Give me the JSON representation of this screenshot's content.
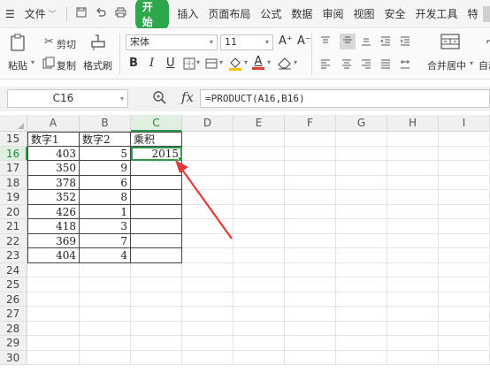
{
  "menubar": {
    "menu_icon": "☰",
    "file": "文件",
    "file_caret": "﹀",
    "tabs": [
      "插入",
      "页面布局",
      "公式",
      "数据",
      "审阅",
      "视图",
      "安全",
      "开发工具",
      "特"
    ],
    "active_tab": "开始"
  },
  "ribbon": {
    "paste_label": "粘贴",
    "cut_label": "剪切",
    "copy_label": "复制",
    "format_painter_label": "格式刷",
    "font_name": "宋体",
    "font_size": "11",
    "bold": "B",
    "italic": "I",
    "underline": "U",
    "grow_font": "A⁺",
    "shrink_font": "A⁻",
    "merge_center_label": "合并居中",
    "auto_wrap_label": "自动",
    "font_color_letter": "A",
    "font_color": "#e03c31",
    "fill_color": "#f2c500"
  },
  "formula_bar": {
    "cell_ref": "C16",
    "fx": "fx",
    "formula": "=PRODUCT(A16,B16)"
  },
  "sheet": {
    "columns": [
      "A",
      "B",
      "C",
      "D",
      "E",
      "F",
      "G",
      "H",
      "I"
    ],
    "selected_column": "C",
    "selected_row": "16",
    "rows": [
      {
        "n": "15",
        "a": "数字1",
        "b": "数字2",
        "c": "乘积"
      },
      {
        "n": "16",
        "a": "403",
        "b": "5",
        "c": "2015"
      },
      {
        "n": "17",
        "a": "350",
        "b": "9",
        "c": ""
      },
      {
        "n": "18",
        "a": "378",
        "b": "6",
        "c": ""
      },
      {
        "n": "19",
        "a": "352",
        "b": "8",
        "c": ""
      },
      {
        "n": "20",
        "a": "426",
        "b": "1",
        "c": ""
      },
      {
        "n": "21",
        "a": "418",
        "b": "3",
        "c": ""
      },
      {
        "n": "22",
        "a": "369",
        "b": "7",
        "c": ""
      },
      {
        "n": "23",
        "a": "404",
        "b": "4",
        "c": ""
      },
      {
        "n": "24",
        "a": "",
        "b": "",
        "c": ""
      },
      {
        "n": "25",
        "a": "",
        "b": "",
        "c": ""
      },
      {
        "n": "26",
        "a": "",
        "b": "",
        "c": ""
      },
      {
        "n": "27",
        "a": "",
        "b": "",
        "c": ""
      },
      {
        "n": "28",
        "a": "",
        "b": "",
        "c": ""
      },
      {
        "n": "29",
        "a": "",
        "b": "",
        "c": ""
      },
      {
        "n": "30",
        "a": "",
        "b": "",
        "c": ""
      }
    ]
  },
  "colors": {
    "accent": "#2da64c",
    "selection": "#2e9b4a",
    "annotation_arrow": "#e23a3a"
  }
}
